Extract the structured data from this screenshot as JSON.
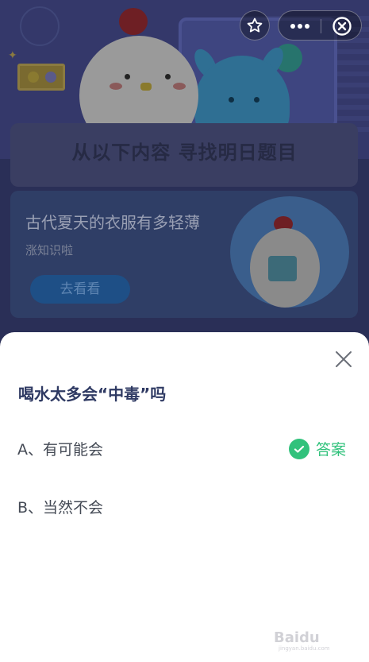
{
  "background": {
    "banner_title": "从以下内容 寻找明日题目",
    "content_card": {
      "title": "古代夏天的衣服有多轻薄",
      "subtitle": "涨知识啦",
      "button_label": "去看看"
    }
  },
  "topbar": {
    "star_icon": "star-outline-icon",
    "more_icon": "more-dots-icon",
    "close_icon": "close-circle-icon"
  },
  "sheet": {
    "question": "喝水太多会“中毒”吗",
    "options": [
      {
        "label": "A、有可能会",
        "is_answer": true
      },
      {
        "label": "B、当然不会",
        "is_answer": false
      }
    ],
    "answer_label": "答案"
  },
  "watermark": {
    "text": "Baidu",
    "sub": "jingyan.baidu.com"
  },
  "colors": {
    "accent_green": "#31c27c",
    "question_text": "#2f3a63",
    "overlay_bg": "#2a2f57"
  }
}
